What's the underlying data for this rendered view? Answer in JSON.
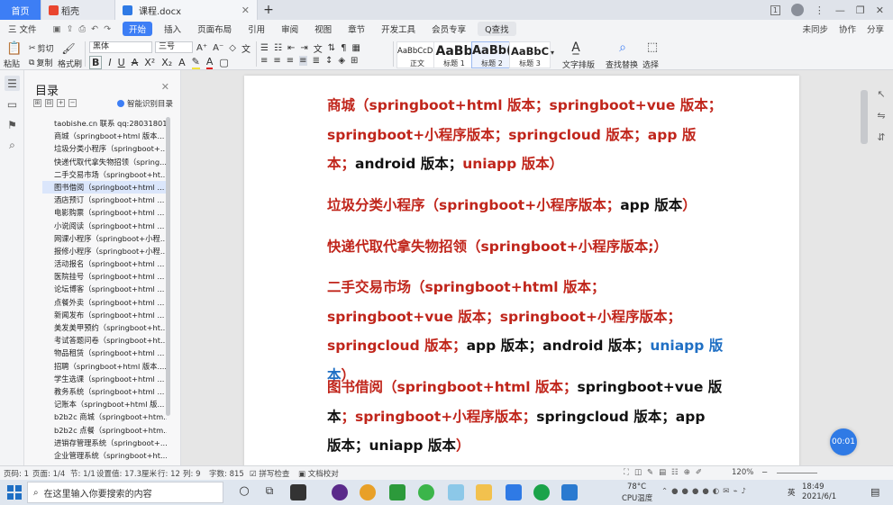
{
  "tabs": {
    "home": "首页",
    "docer": "稻壳",
    "doc": "课程.docx",
    "add": "+"
  },
  "window": {
    "badge": "1"
  },
  "menu": {
    "file": "三 文件",
    "items": [
      "开始",
      "插入",
      "页面布局",
      "引用",
      "审阅",
      "视图",
      "章节",
      "开发工具",
      "会员专享"
    ],
    "search": "Q查找",
    "right": [
      "未同步",
      "协作",
      "分享"
    ]
  },
  "ribbon": {
    "paste": "粘贴",
    "cut": "剪切",
    "copy": "复制",
    "format_painter": "格式刷",
    "font_name": "黑体",
    "font_size": "三号",
    "styles": [
      {
        "sample": "AaBbCcDd",
        "name": "正文"
      },
      {
        "sample": "AaBb",
        "name": "标题 1"
      },
      {
        "sample": "AaBb(",
        "name": "标题 2"
      },
      {
        "sample": "AaBbC",
        "name": "标题 3"
      }
    ],
    "text_layout": "文字排版",
    "find_replace": "查找替换",
    "select": "选择"
  },
  "toc": {
    "title": "目录",
    "smart": "智能识别目录",
    "items": [
      "taobishe.cn 联系 qq:28031801 ...",
      "商城（springboot+html 版本...",
      "垃圾分类小程序（springboot+...",
      "快递代取代拿失物招领（spring...",
      "二手交易市场（springboot+ht...",
      "图书借阅（springboot+html ...",
      "酒店预订（springboot+html ...",
      "电影购票（springboot+html ...",
      "小说阅读（springboot+html ...",
      "网课小程序（springboot+小程...",
      "报修小程序（springboot+小程...",
      "活动报名（springboot+html ...",
      "医院挂号（springboot+html ...",
      "论坛博客（springboot+html ...",
      "点餐外卖（springboot+html ...",
      "新闻发布（springboot+html ...",
      "美发美甲预约（springboot+ht...",
      "考试答题问卷（springboot+ht...",
      "物品租赁（springboot+html ...",
      "招聘（springboot+html 版本......",
      "学生选课（springboot+html ...",
      "教务系统（springboot+html ...",
      "记账本（springboot+html 版...",
      "b2b2c 商城（springboot+htm...",
      "b2b2c 点餐（springboot+htm...",
      "进销存管理系统（springboot+...",
      "企业管理系统（springboot+ht..."
    ],
    "selected_index": 5
  },
  "doc": {
    "p1": [
      {
        "t": "商城（springboot+html 版本；springboot+vue 版本；springboot+小程序版本；springcloud 版本；app 版本；",
        "c": "red"
      },
      {
        "t": "android 版本；",
        "c": "black"
      },
      {
        "t": "uniapp 版本）",
        "c": "red"
      }
    ],
    "p2": [
      {
        "t": "垃圾分类小程序（springboot+小程序版本；",
        "c": "red"
      },
      {
        "t": "app 版本",
        "c": "black"
      },
      {
        "t": "）",
        "c": "red"
      }
    ],
    "p3": [
      {
        "t": "快递代取代拿失物招领（springboot+小程序版本;）",
        "c": "red"
      }
    ],
    "p4": [
      {
        "t": "二手交易市场（springboot+html 版本；springboot+vue 版本；springboot+小程序版本；springcloud 版本；",
        "c": "red"
      },
      {
        "t": "app 版本；android 版本；",
        "c": "black"
      },
      {
        "t": "uniapp 版本",
        "c": "blue"
      },
      {
        "t": "）",
        "c": "red"
      }
    ],
    "p5": [
      {
        "t": "图书借阅（springboot+html 版本；",
        "c": "red"
      },
      {
        "t": "springboot+vue 版本",
        "c": "black"
      },
      {
        "t": "；springboot+小程序版本；",
        "c": "red"
      },
      {
        "t": "springcloud 版本；app 版本；uniapp 版本",
        "c": "black"
      },
      {
        "t": "）",
        "c": "red"
      }
    ]
  },
  "status": {
    "page": "页码: 1",
    "pages": "页面: 1/4",
    "section": "节: 1/1",
    "position": "设置值: 17.3厘米",
    "row": "行: 12",
    "col": "列: 9",
    "words": "字数: 815",
    "spell": "拼写检查",
    "proof": "文档校对",
    "zoom": "120%"
  },
  "widgets": {
    "timer": "00:01"
  },
  "taskbar": {
    "search_placeholder": "在这里输入你要搜索的内容",
    "temp": "78°C",
    "temp_label": "CPU温度",
    "ime": "英",
    "time": "18:49",
    "date": "2021/6/1"
  },
  "colors": {
    "accent": "#3d7ef5",
    "doc_red": "#c0251b",
    "doc_blue": "#1f6fc4"
  }
}
